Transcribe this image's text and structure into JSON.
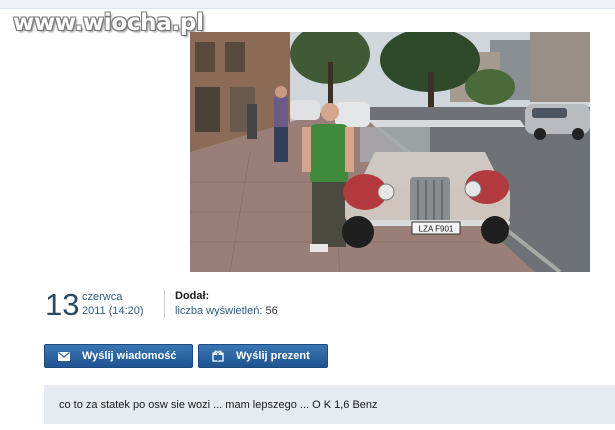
{
  "watermark": {
    "text": "www.wiocha.pl"
  },
  "post": {
    "photo": {
      "plate_text": "LZA F901"
    },
    "date": {
      "day": "13",
      "month": "czerwca",
      "year_time": "2011 (14:20)"
    },
    "added_by_label": "Dodał:",
    "views_label": "liczba wyświetleń:",
    "views_count": "56",
    "buttons": {
      "send_message": "Wyślij wiadomość",
      "send_gift": "Wyślij prezent"
    },
    "description": "co to za statek po osw sie wozi ... mam lepszego ... O K 1,6 Benz"
  },
  "colors": {
    "button": "#2a64a2",
    "comment_bg": "#e6ebf2",
    "date": "#2d4a63"
  },
  "icons": {
    "message": "envelope-icon",
    "gift": "gift-icon"
  }
}
